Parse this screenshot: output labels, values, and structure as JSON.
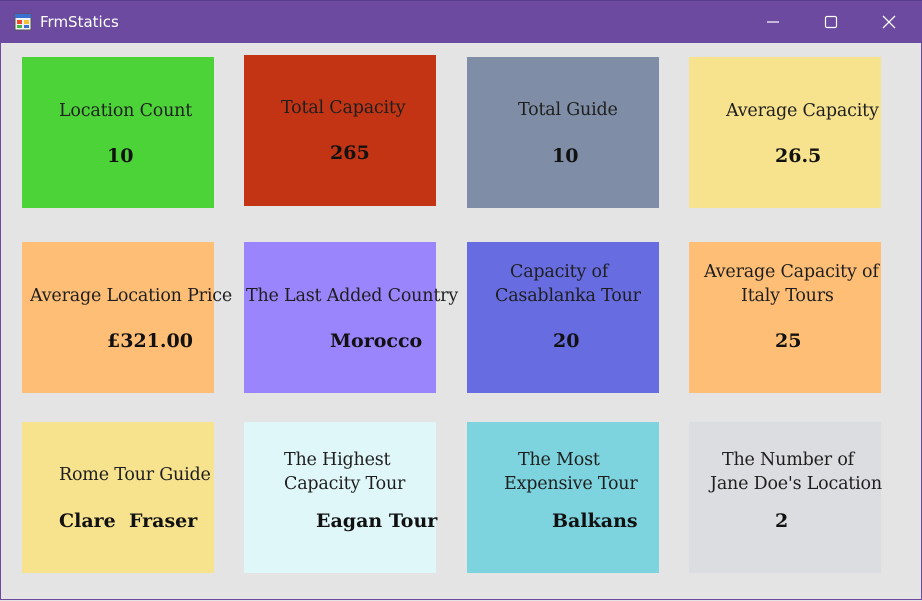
{
  "window": {
    "title": "FrmStatics"
  },
  "colors": {
    "titlebar": "#6b4aa0",
    "background": "#e4e4e4"
  },
  "icons": {
    "app": "form-app-icon",
    "minimize": "minimize-icon",
    "maximize": "maximize-icon",
    "close": "close-icon"
  },
  "cards": [
    {
      "label": "Location Count",
      "value": "10",
      "color": "#4cd337"
    },
    {
      "label": "Total Capacity",
      "value": "265",
      "color": "#c23414"
    },
    {
      "label": "Total Guide",
      "value": "10",
      "color": "#7f8ea6"
    },
    {
      "label": "Average Capacity",
      "value": "26.5",
      "color": "#f7e28e"
    },
    {
      "label": "Average Location Price",
      "value": "£321.00",
      "color": "#ffbe75"
    },
    {
      "label": "The Last Added Country",
      "value": "Morocco",
      "color": "#9b85fc"
    },
    {
      "label_line1": "Capacity of",
      "label_line2": "Casablanka Tour",
      "value": "20",
      "color": "#676ce1"
    },
    {
      "label_line1": "Average Capacity of",
      "label_line2": "Italy Tours",
      "value": "25",
      "color": "#ffbe75"
    },
    {
      "label": "Rome Tour Guide",
      "value": "Clare  Fraser",
      "color": "#f7e28e"
    },
    {
      "label_line1": "The Highest",
      "label_line2": "Capacity Tour",
      "value": "Eagan Tour",
      "color": "#e0f7fa"
    },
    {
      "label_line1": "The Most",
      "label_line2": "Expensive Tour",
      "value": "Balkans",
      "color": "#7dd4de"
    },
    {
      "label_line1": "The Number of",
      "label_line2": "Jane Doe's Location",
      "value": "2",
      "color": "#dcdde0"
    }
  ]
}
